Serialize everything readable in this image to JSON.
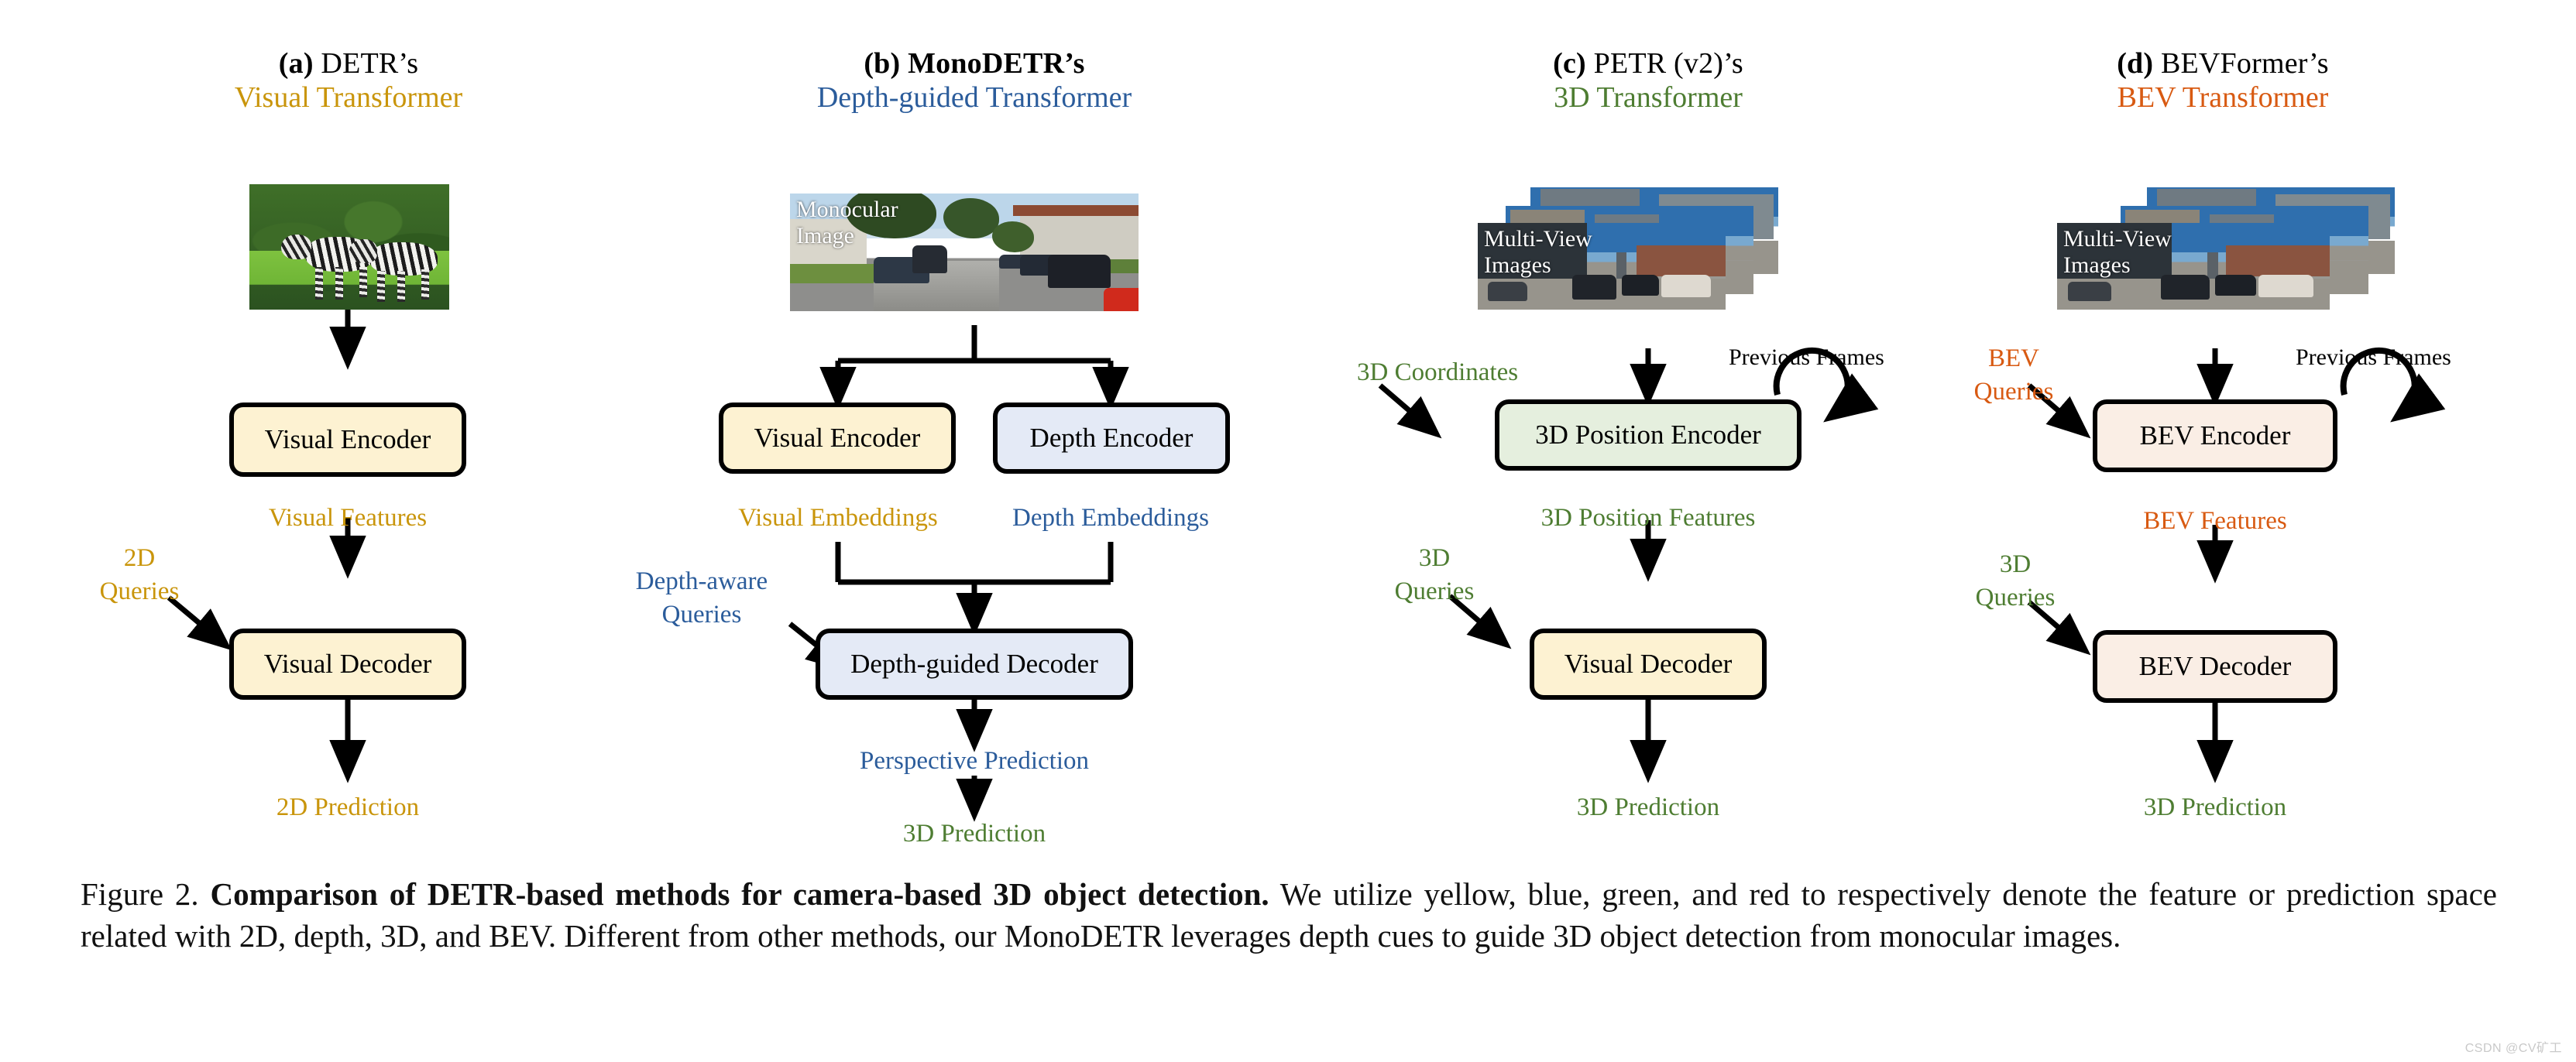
{
  "figure": {
    "caption_label": "Figure 2.",
    "caption_bold": "Comparison of DETR-based methods for camera-based 3D object detection.",
    "caption_rest": "We utilize yellow, blue, green, and red to respectively denote the feature or prediction space related with 2D, depth, 3D, and BEV. Different from other methods, our MonoDETR leverages depth cues to guide 3D object detection from monocular images.",
    "watermark": "CSDN @CV矿工"
  },
  "colors": {
    "yellow": "#C9950B",
    "blue": "#2B5C9B",
    "green": "#4E7D32",
    "red": "#D85A12",
    "black": "#000000",
    "fill_yellow": "#FDF2D2",
    "fill_blue": "#E4EAF6",
    "fill_green": "#E5EFDE",
    "fill_peach": "#FAEEE5"
  },
  "columns": [
    {
      "id": "a",
      "tag": "(a)",
      "title_plain": "DETR’s",
      "subtitle": "Visual Transformer",
      "subtitle_color": "yellow",
      "image_overlay": "",
      "image_kind": "zebra-photo",
      "boxes": [
        {
          "label": "Visual Encoder",
          "fill": "yellow"
        },
        {
          "label": "Visual Decoder",
          "fill": "yellow"
        }
      ],
      "labels": [
        {
          "text": "Visual Features",
          "color": "yellow"
        },
        {
          "text": "2D\nQueries",
          "color": "yellow"
        },
        {
          "text": "2D Prediction",
          "color": "yellow"
        }
      ]
    },
    {
      "id": "b",
      "tag": "(b)",
      "title_bold": "MonoDETR’s",
      "subtitle": "Depth-guided Transformer",
      "subtitle_color": "blue",
      "image_overlay": "Monocular\nImage",
      "image_kind": "kitti-street-photo",
      "boxes": [
        {
          "label": "Visual Encoder",
          "fill": "yellow"
        },
        {
          "label": "Depth Encoder",
          "fill": "blue"
        },
        {
          "label": "Depth-guided Decoder",
          "fill": "blue"
        }
      ],
      "labels": [
        {
          "text": "Visual Embeddings",
          "color": "yellow"
        },
        {
          "text": "Depth Embeddings",
          "color": "blue"
        },
        {
          "text": "Depth-aware\nQueries",
          "color": "blue"
        },
        {
          "text": "Perspective Prediction",
          "color": "blue"
        },
        {
          "text": "3D Prediction",
          "color": "green"
        }
      ]
    },
    {
      "id": "c",
      "tag": "(c)",
      "title_plain": "PETR (v2)’s",
      "subtitle": "3D Transformer",
      "subtitle_color": "green",
      "image_overlay": "Multi-View\nImages",
      "image_kind": "nuscenes-multiview-stack",
      "boxes": [
        {
          "label": "3D Position Encoder",
          "fill": "green"
        },
        {
          "label": "Visual Decoder",
          "fill": "yellow"
        }
      ],
      "labels": [
        {
          "text": "3D Coordinates",
          "color": "green"
        },
        {
          "text": "Previous Frames",
          "color": "black"
        },
        {
          "text": "3D Position Features",
          "color": "green"
        },
        {
          "text": "3D\nQueries",
          "color": "green"
        },
        {
          "text": "3D Prediction",
          "color": "green"
        }
      ]
    },
    {
      "id": "d",
      "tag": "(d)",
      "title_plain": "BEVFormer’s",
      "subtitle": "BEV Transformer",
      "subtitle_color": "red",
      "image_overlay": "Multi-View\nImages",
      "image_kind": "nuscenes-multiview-stack",
      "boxes": [
        {
          "label": "BEV Encoder",
          "fill": "peach"
        },
        {
          "label": "BEV Decoder",
          "fill": "peach"
        }
      ],
      "labels": [
        {
          "text": "BEV\nQueries",
          "color": "red"
        },
        {
          "text": "Previous Frames",
          "color": "black"
        },
        {
          "text": "BEV Features",
          "color": "red"
        },
        {
          "text": "3D\nQueries",
          "color": "green"
        },
        {
          "text": "3D Prediction",
          "color": "green"
        }
      ]
    }
  ]
}
